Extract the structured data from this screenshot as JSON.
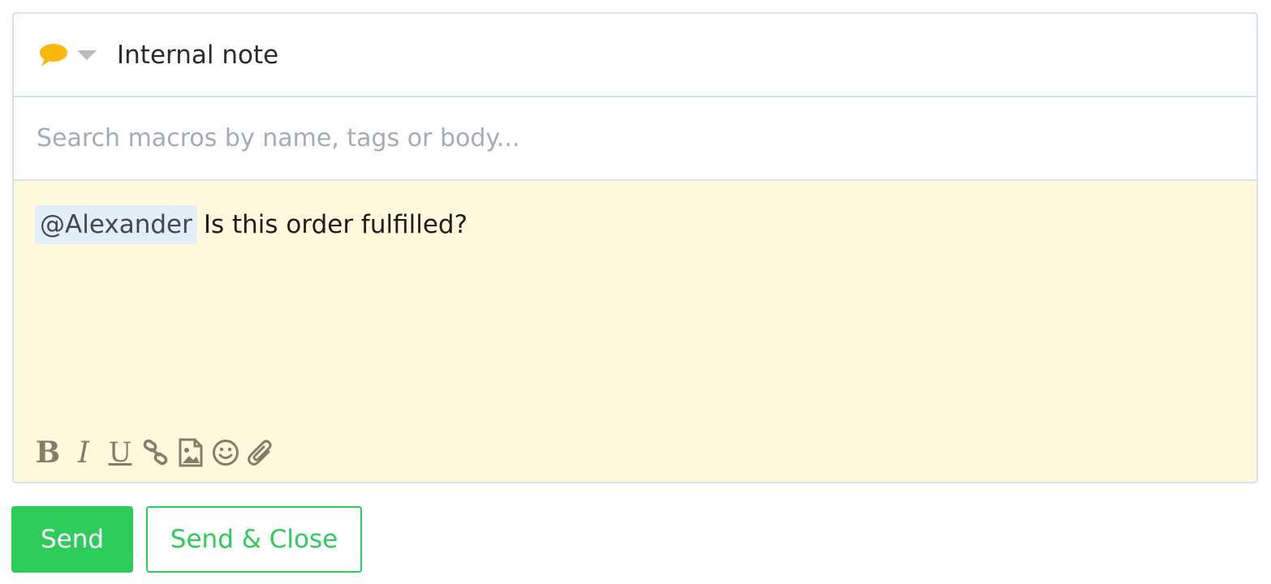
{
  "composer": {
    "channel": {
      "icon": "speech-bubble-icon",
      "icon_color": "#f9b80b",
      "caret_icon": "chevron-down-icon",
      "label": "Internal note"
    },
    "search": {
      "placeholder": "Search macros by name, tags or body...",
      "value": ""
    },
    "editor": {
      "background": "#fef9dc",
      "mention": "@Alexander",
      "text": "Is this order fulfilled?"
    },
    "toolbar": {
      "bold_label": "B",
      "italic_label": "I",
      "underline_label": "U",
      "icons": [
        "bold-icon",
        "italic-icon",
        "underline-icon",
        "link-icon",
        "image-icon",
        "emoji-icon",
        "attachment-icon"
      ]
    }
  },
  "actions": {
    "send_label": "Send",
    "send_close_label": "Send & Close",
    "accent_color": "#2ecc5a"
  }
}
